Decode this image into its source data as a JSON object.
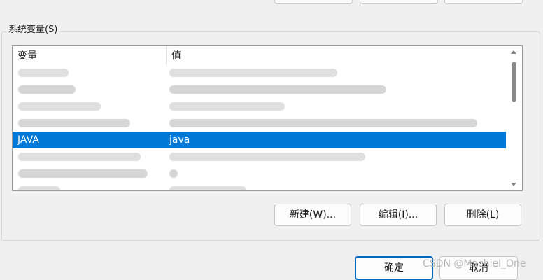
{
  "system_vars": {
    "group_title": "系统变量(S)",
    "columns": {
      "variable": "变量",
      "value": "值"
    },
    "selected_row": {
      "variable": "JAVA",
      "value": "java"
    },
    "buttons": {
      "new": "新建(W)...",
      "edit": "编辑(I)...",
      "delete": "删除(L)"
    }
  },
  "dialog_buttons": {
    "ok": "确定",
    "cancel": "取消"
  },
  "watermark": "CSDN @Machiel_One"
}
